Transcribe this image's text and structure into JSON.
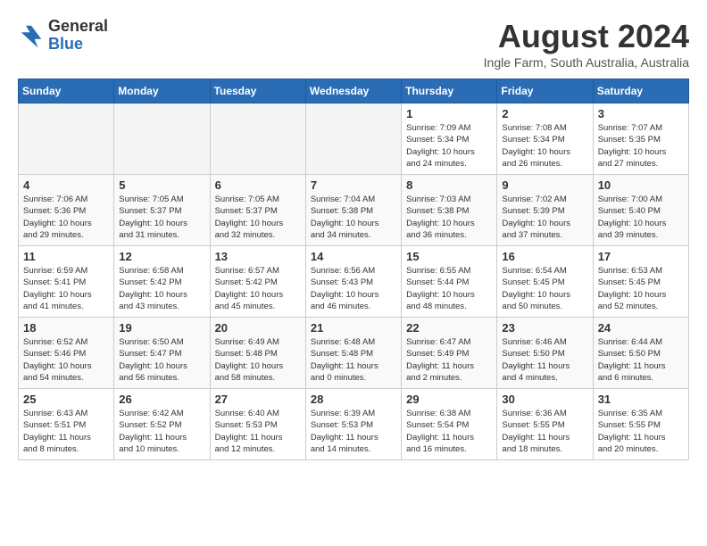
{
  "header": {
    "logo_general": "General",
    "logo_blue": "Blue",
    "month_title": "August 2024",
    "location": "Ingle Farm, South Australia, Australia"
  },
  "weekdays": [
    "Sunday",
    "Monday",
    "Tuesday",
    "Wednesday",
    "Thursday",
    "Friday",
    "Saturday"
  ],
  "weeks": [
    [
      {
        "day": "",
        "info": ""
      },
      {
        "day": "",
        "info": ""
      },
      {
        "day": "",
        "info": ""
      },
      {
        "day": "",
        "info": ""
      },
      {
        "day": "1",
        "info": "Sunrise: 7:09 AM\nSunset: 5:34 PM\nDaylight: 10 hours\nand 24 minutes."
      },
      {
        "day": "2",
        "info": "Sunrise: 7:08 AM\nSunset: 5:34 PM\nDaylight: 10 hours\nand 26 minutes."
      },
      {
        "day": "3",
        "info": "Sunrise: 7:07 AM\nSunset: 5:35 PM\nDaylight: 10 hours\nand 27 minutes."
      }
    ],
    [
      {
        "day": "4",
        "info": "Sunrise: 7:06 AM\nSunset: 5:36 PM\nDaylight: 10 hours\nand 29 minutes."
      },
      {
        "day": "5",
        "info": "Sunrise: 7:05 AM\nSunset: 5:37 PM\nDaylight: 10 hours\nand 31 minutes."
      },
      {
        "day": "6",
        "info": "Sunrise: 7:05 AM\nSunset: 5:37 PM\nDaylight: 10 hours\nand 32 minutes."
      },
      {
        "day": "7",
        "info": "Sunrise: 7:04 AM\nSunset: 5:38 PM\nDaylight: 10 hours\nand 34 minutes."
      },
      {
        "day": "8",
        "info": "Sunrise: 7:03 AM\nSunset: 5:38 PM\nDaylight: 10 hours\nand 36 minutes."
      },
      {
        "day": "9",
        "info": "Sunrise: 7:02 AM\nSunset: 5:39 PM\nDaylight: 10 hours\nand 37 minutes."
      },
      {
        "day": "10",
        "info": "Sunrise: 7:00 AM\nSunset: 5:40 PM\nDaylight: 10 hours\nand 39 minutes."
      }
    ],
    [
      {
        "day": "11",
        "info": "Sunrise: 6:59 AM\nSunset: 5:41 PM\nDaylight: 10 hours\nand 41 minutes."
      },
      {
        "day": "12",
        "info": "Sunrise: 6:58 AM\nSunset: 5:42 PM\nDaylight: 10 hours\nand 43 minutes."
      },
      {
        "day": "13",
        "info": "Sunrise: 6:57 AM\nSunset: 5:42 PM\nDaylight: 10 hours\nand 45 minutes."
      },
      {
        "day": "14",
        "info": "Sunrise: 6:56 AM\nSunset: 5:43 PM\nDaylight: 10 hours\nand 46 minutes."
      },
      {
        "day": "15",
        "info": "Sunrise: 6:55 AM\nSunset: 5:44 PM\nDaylight: 10 hours\nand 48 minutes."
      },
      {
        "day": "16",
        "info": "Sunrise: 6:54 AM\nSunset: 5:45 PM\nDaylight: 10 hours\nand 50 minutes."
      },
      {
        "day": "17",
        "info": "Sunrise: 6:53 AM\nSunset: 5:45 PM\nDaylight: 10 hours\nand 52 minutes."
      }
    ],
    [
      {
        "day": "18",
        "info": "Sunrise: 6:52 AM\nSunset: 5:46 PM\nDaylight: 10 hours\nand 54 minutes."
      },
      {
        "day": "19",
        "info": "Sunrise: 6:50 AM\nSunset: 5:47 PM\nDaylight: 10 hours\nand 56 minutes."
      },
      {
        "day": "20",
        "info": "Sunrise: 6:49 AM\nSunset: 5:48 PM\nDaylight: 10 hours\nand 58 minutes."
      },
      {
        "day": "21",
        "info": "Sunrise: 6:48 AM\nSunset: 5:48 PM\nDaylight: 11 hours\nand 0 minutes."
      },
      {
        "day": "22",
        "info": "Sunrise: 6:47 AM\nSunset: 5:49 PM\nDaylight: 11 hours\nand 2 minutes."
      },
      {
        "day": "23",
        "info": "Sunrise: 6:46 AM\nSunset: 5:50 PM\nDaylight: 11 hours\nand 4 minutes."
      },
      {
        "day": "24",
        "info": "Sunrise: 6:44 AM\nSunset: 5:50 PM\nDaylight: 11 hours\nand 6 minutes."
      }
    ],
    [
      {
        "day": "25",
        "info": "Sunrise: 6:43 AM\nSunset: 5:51 PM\nDaylight: 11 hours\nand 8 minutes."
      },
      {
        "day": "26",
        "info": "Sunrise: 6:42 AM\nSunset: 5:52 PM\nDaylight: 11 hours\nand 10 minutes."
      },
      {
        "day": "27",
        "info": "Sunrise: 6:40 AM\nSunset: 5:53 PM\nDaylight: 11 hours\nand 12 minutes."
      },
      {
        "day": "28",
        "info": "Sunrise: 6:39 AM\nSunset: 5:53 PM\nDaylight: 11 hours\nand 14 minutes."
      },
      {
        "day": "29",
        "info": "Sunrise: 6:38 AM\nSunset: 5:54 PM\nDaylight: 11 hours\nand 16 minutes."
      },
      {
        "day": "30",
        "info": "Sunrise: 6:36 AM\nSunset: 5:55 PM\nDaylight: 11 hours\nand 18 minutes."
      },
      {
        "day": "31",
        "info": "Sunrise: 6:35 AM\nSunset: 5:55 PM\nDaylight: 11 hours\nand 20 minutes."
      }
    ]
  ]
}
